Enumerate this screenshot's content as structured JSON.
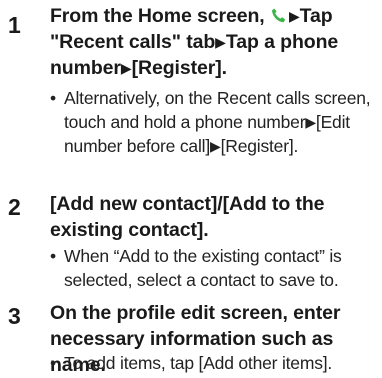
{
  "steps": [
    {
      "number": "1",
      "title_part1": "From the Home screen,",
      "arrow": "▶",
      "title_part2": "Tap \"Recent calls\" tab",
      "title_part3": "Tap a phone number",
      "title_part4": "[Register].",
      "note_part1": "Alternatively, on the Recent calls screen, touch and hold a phone number",
      "note_part2": "[Edit number before call]",
      "note_part3": "[Register]."
    },
    {
      "number": "2",
      "title": "[Add new contact]/[Add to the existing contact].",
      "note": "When “Add to the existing contact” is selected, select a contact to save to."
    },
    {
      "number": "3",
      "title": "On the profile edit screen, enter necessary information such as name.",
      "note": "To add items, tap [Add other items]."
    }
  ],
  "bullet": "•",
  "icons": {
    "phone": "phone-icon",
    "phone_color": "#3bb54a"
  }
}
